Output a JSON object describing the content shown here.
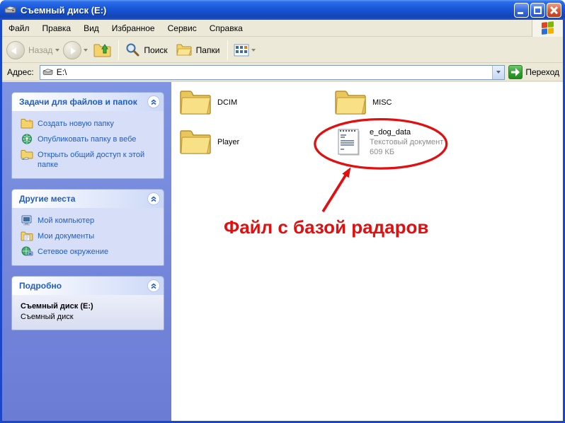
{
  "window": {
    "title": "Съемный диск (E:)"
  },
  "menu": {
    "items": [
      "Файл",
      "Правка",
      "Вид",
      "Избранное",
      "Сервис",
      "Справка"
    ]
  },
  "toolbar": {
    "back_label": "Назад",
    "search_label": "Поиск",
    "folders_label": "Папки"
  },
  "address": {
    "label": "Адрес:",
    "value": "E:\\",
    "go_label": "Переход"
  },
  "sidebar": {
    "panels": [
      {
        "title": "Задачи для файлов и папок",
        "items": [
          {
            "icon": "new-folder-icon",
            "label": "Создать новую папку"
          },
          {
            "icon": "publish-web-icon",
            "label": "Опубликовать папку в вебе"
          },
          {
            "icon": "share-folder-icon",
            "label": "Открыть общий доступ к этой папке"
          }
        ]
      },
      {
        "title": "Другие места",
        "items": [
          {
            "icon": "my-computer-icon",
            "label": "Мой компьютер"
          },
          {
            "icon": "my-documents-icon",
            "label": "Мои документы"
          },
          {
            "icon": "network-places-icon",
            "label": "Сетевое окружение"
          }
        ]
      },
      {
        "title": "Подробно",
        "details": {
          "name": "Съемный диск (E:)",
          "type": "Съемный диск"
        }
      }
    ]
  },
  "main": {
    "folders": [
      {
        "name": "DCIM"
      },
      {
        "name": "MISC"
      },
      {
        "name": "Player"
      }
    ],
    "file": {
      "name": "e_dog_data",
      "type": "Текстовый документ",
      "size": "609 КБ"
    }
  },
  "annotation": {
    "text": "Файл с базой радаров",
    "color": "#e01010"
  },
  "colors": {
    "titlebar": "#1856d8",
    "sidebar": "#6b7cd5",
    "link": "#215dc6",
    "toolbar_bg": "#ece9d8"
  }
}
